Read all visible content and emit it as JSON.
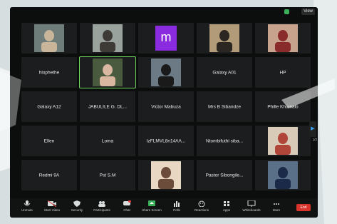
{
  "top_bar": {
    "view_label": "View"
  },
  "participants": [
    {
      "name": "",
      "kind": "photo"
    },
    {
      "name": "",
      "kind": "photo"
    },
    {
      "name": "m",
      "kind": "avatar",
      "color": "#8b2be0"
    },
    {
      "name": "",
      "kind": "photo"
    },
    {
      "name": "",
      "kind": "photo"
    },
    {
      "name": "hlophethe",
      "kind": "name"
    },
    {
      "name": "",
      "kind": "photo",
      "active": true
    },
    {
      "name": "",
      "kind": "photo"
    },
    {
      "name": "Galaxy A01",
      "kind": "name"
    },
    {
      "name": "HP",
      "kind": "name"
    },
    {
      "name": "Galaxy A12",
      "kind": "name"
    },
    {
      "name": "JABULILE G. DL...",
      "kind": "name"
    },
    {
      "name": "Victor Mabuza",
      "kind": "name"
    },
    {
      "name": "Mrs B Sibandze",
      "kind": "name"
    },
    {
      "name": "Phille Khumalo",
      "kind": "name"
    },
    {
      "name": "Ellen",
      "kind": "name"
    },
    {
      "name": "Loma",
      "kind": "name"
    },
    {
      "name": "IzFLMVL8n14AA...",
      "kind": "name"
    },
    {
      "name": "Ntombifuthi siba...",
      "kind": "name"
    },
    {
      "name": "",
      "kind": "photo"
    },
    {
      "name": "Redmi 9A",
      "kind": "name"
    },
    {
      "name": "Pst S.M",
      "kind": "name"
    },
    {
      "name": "",
      "kind": "photo"
    },
    {
      "name": "Pastor Sibongile...",
      "kind": "name"
    },
    {
      "name": "",
      "kind": "photo"
    }
  ],
  "toolbar": {
    "items": [
      {
        "label": "Unmute",
        "icon": "microphone-icon"
      },
      {
        "label": "Start Video",
        "icon": "video-camera-icon"
      },
      {
        "label": "Security",
        "icon": "shield-icon"
      },
      {
        "label": "Participants",
        "icon": "participants-icon"
      },
      {
        "label": "Chat",
        "icon": "chat-icon"
      },
      {
        "label": "Share Screen",
        "icon": "share-screen-icon"
      },
      {
        "label": "Polls",
        "icon": "polls-icon"
      },
      {
        "label": "Reactions",
        "icon": "reactions-icon"
      },
      {
        "label": "Apps",
        "icon": "apps-icon"
      },
      {
        "label": "Whiteboards",
        "icon": "whiteboard-icon"
      },
      {
        "label": "More",
        "icon": "more-icon"
      }
    ],
    "end_label": "End"
  },
  "page_indicator": "1/2",
  "colors": {
    "accent_green": "#6bd25a",
    "share_green": "#3bb05a",
    "end_red": "#d9342b",
    "avatar_purple": "#8b2be0"
  }
}
